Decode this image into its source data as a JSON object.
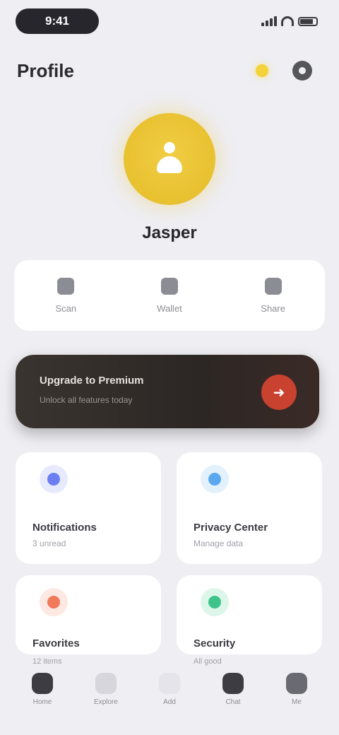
{
  "status_bar": {
    "time": "9:41"
  },
  "header": {
    "title": "Profile"
  },
  "profile": {
    "username": "Jasper"
  },
  "quick_actions": [
    {
      "label": "Scan",
      "icon": "scan-icon"
    },
    {
      "label": "Wallet",
      "icon": "wallet-icon"
    },
    {
      "label": "Share",
      "icon": "share-icon"
    }
  ],
  "banner": {
    "title": "Upgrade to Premium",
    "subtitle": "Unlock all features today",
    "action_icon": "arrow-right-icon"
  },
  "tiles": [
    {
      "title": "Notifications",
      "subtitle": "3 unread",
      "color": "#6b7ef2",
      "icon": "bell-icon"
    },
    {
      "title": "Privacy Center",
      "subtitle": "Manage data",
      "color": "#5aa8f0",
      "icon": "shield-icon"
    },
    {
      "title": "Favorites",
      "subtitle": "12 items",
      "color": "#f07a5a",
      "icon": "heart-icon"
    },
    {
      "title": "Security",
      "subtitle": "All good",
      "color": "#3ec48a",
      "icon": "lock-icon"
    }
  ],
  "tabbar": [
    {
      "label": "Home",
      "icon": "home-icon"
    },
    {
      "label": "Explore",
      "icon": "compass-icon"
    },
    {
      "label": "Add",
      "icon": "plus-icon"
    },
    {
      "label": "Chat",
      "icon": "chat-icon"
    },
    {
      "label": "Me",
      "icon": "user-icon"
    }
  ],
  "colors": {
    "accent": "#e8c130",
    "banner_bg": "#2c2724",
    "banner_button": "#c9412f"
  }
}
